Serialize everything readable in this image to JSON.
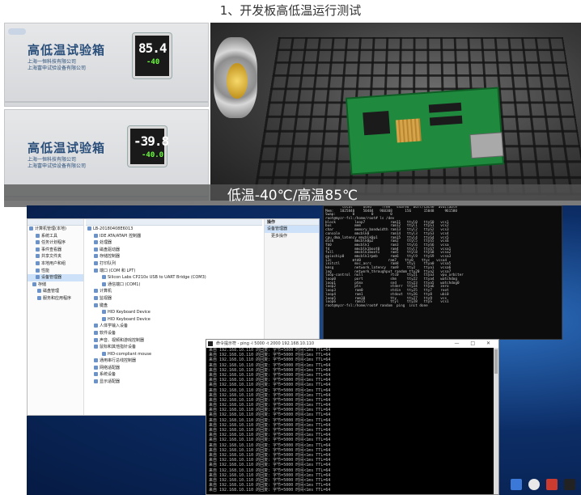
{
  "title": "1、开发板高低温运行测试",
  "chambers": [
    {
      "name": "高低温试验箱",
      "company_line1": "上海一恒科技有限公司",
      "company_line2": "上海富申试验设备有限公司",
      "reading_top": "85.4",
      "reading_bottom": "-40"
    },
    {
      "name": "高低温试验箱",
      "company_line1": "上海一恒科技有限公司",
      "company_line2": "上海富申试验设备有限公司",
      "reading_top": "-39.8",
      "reading_bottom": "-40.0"
    }
  ],
  "caption": "低温-40℃/高温85℃",
  "device_manager": {
    "left_tree": [
      "计算机管理(本地)",
      "系统工具",
      "任务计划程序",
      "事件查看器",
      "共享文件夹",
      "本地用户和组",
      "性能",
      "设备管理器",
      "存储",
      "磁盘管理",
      "服务和应用程序"
    ],
    "left_tree_selected": 7,
    "mid_tree": [
      "LB-20180408E6013",
      "IDE ATA/ATAPI 控制器",
      "处理器",
      "磁盘驱动器",
      "存储控制器",
      "打印队列",
      "端口 (COM 和 LPT)",
      "Silicon Labs CP210x USB to UART Bridge (COM3)",
      "通信端口 (COM1)",
      "计算机",
      "监视器",
      "键盘",
      "HID Keyboard Device",
      "HID Keyboard Device",
      "人体学输入设备",
      "软件设备",
      "声音、视频和游戏控制器",
      "鼠标和其他指针设备",
      "HID-compliant mouse",
      "通用串行总线控制器",
      "网络适配器",
      "系统设备",
      "显示适配器"
    ],
    "actions_title": "操作",
    "actions": [
      "设备管理器",
      "更多操作"
    ]
  },
  "terminal1": {
    "lines": [
      "        total     used     free   shared  buff/cache  available",
      "Mem:   1025840    50484   960308      156      15048     961580",
      "Swap:        0        0        0",
      "root@myzr-fsl:/home/root# ls /dev",
      "block         loop7            ram11   ttyl0   ttyS0   vcs1",
      "bus           mem              ram12   ttyl1   ttyS1   vcs2",
      "char          memory_bandwidth ram13   ttyl2   ttyS2   vcs3",
      "console       mmcblk0          ram14   ttyl3   ttyS3   vcs4",
      "cpu_dma_latency mmcblk0p1      ram15   ttyl4   ttyS4   vcs5",
      "disk          mmcblk0p2        ram2    ttyl5   ttyS5   vcs6",
      "fb0           mmcblk1          ram3    ttyl6   ttyS6   vcsa",
      "fd            mmcblk1boot0     ram4    ttyl7   ttyS7   vcsa1",
      "full          mmcblk1boot1     ram5    ttyl8   ttyS8   vcsa2",
      "gpiochip0     mmcblk1rpmb      ram6    ttyl9   ttyS9   vcsa3",
      "i2c          mtd0             ram7    tty0    ttyc   vcsa4",
      "initctl       mxc_asrc         ram8    tty1    ttya0   vcsa5",
      "kmsg          network_latency  ram9    tty2    ttya1   vcsa6",
      "log           network_throughput random tty20  ttya2   vcsa7",
      "loop-control  null             rtc0    tty21   ttya3   vpu_arbiter",
      "loop0         port             shm     tty22   ttya4   watchdog",
      "loop1         ptmx             snd     tty23   ttya5   watchdog0",
      "loop2         pts              stderr  tty24   ttya6   zero",
      "loop3         ram0             stdin   tty25   tty7    root",
      "loop4         ram1             stdout  tty26   tty8    ubi0",
      "loop5         ram10            tty     tty27   tty9    vcs",
      "loop6         ram15            ttyl    tty28   ttyS    vcs1",
      "root@myzr-fsl:/home/root# random  ping  init done"
    ]
  },
  "terminal2": {
    "title": "命令提示符 - ping -l 5000 -t 2000 192.168.10.110",
    "line": "来自 192.168.10.110 的回复: 字节=5000 时间<1ms TTL=64",
    "line_count": 29,
    "buttons": "— □ ✕"
  },
  "colors": {
    "accent": "#1f8a3e",
    "desktop": "#0c2d66",
    "led_green": "#6bff3a"
  }
}
